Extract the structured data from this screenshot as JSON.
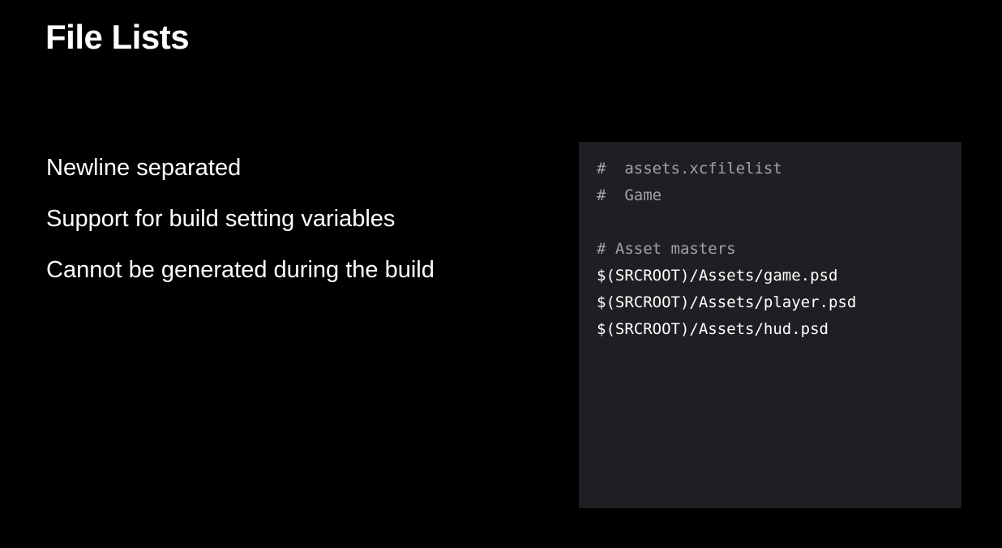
{
  "slide": {
    "title": "File Lists",
    "bullets": [
      "Newline separated",
      "Support for build setting variables",
      "Cannot be generated during the build"
    ]
  },
  "code": {
    "lines": [
      {
        "text": "#  assets.xcfilelist",
        "kind": "comment"
      },
      {
        "text": "#  Game",
        "kind": "comment"
      },
      {
        "text": "",
        "kind": "blank"
      },
      {
        "text": "# Asset masters",
        "kind": "comment"
      },
      {
        "text": "$(SRCROOT)/Assets/game.psd",
        "kind": "path"
      },
      {
        "text": "$(SRCROOT)/Assets/player.psd",
        "kind": "path"
      },
      {
        "text": "$(SRCROOT)/Assets/hud.psd",
        "kind": "path"
      }
    ],
    "colors": {
      "background": "#1f1f23",
      "comment": "#a1a1a8",
      "path": "#ffffff"
    }
  }
}
